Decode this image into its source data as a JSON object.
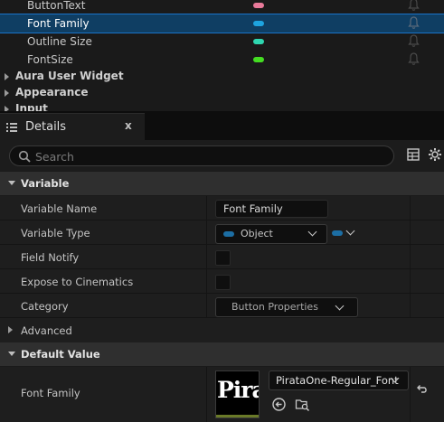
{
  "variables": [
    {
      "name": "ButtonText",
      "color": "#e87a9a",
      "selected": false
    },
    {
      "name": "Font Family",
      "color": "#1ea4e0",
      "selected": true
    },
    {
      "name": "Outline Size",
      "color": "#2ed6b0",
      "selected": false
    },
    {
      "name": "FontSize",
      "color": "#44dd22",
      "selected": false
    }
  ],
  "categories": [
    {
      "name": "Aura User Widget"
    },
    {
      "name": "Appearance"
    },
    {
      "name": "Input"
    }
  ],
  "tab": {
    "label": "Details",
    "close": "x"
  },
  "search": {
    "placeholder": "Search",
    "value": ""
  },
  "sections": {
    "variable": "Variable",
    "advanced": "Advanced",
    "default_value": "Default Value"
  },
  "props": {
    "variable_name": {
      "label": "Variable Name",
      "value": "Font Family"
    },
    "variable_type": {
      "label": "Variable Type",
      "value": "Object"
    },
    "field_notify": {
      "label": "Field Notify"
    },
    "expose": {
      "label": "Expose to Cinematics"
    },
    "category": {
      "label": "Category",
      "value": "Button Properties"
    },
    "font_family": {
      "label": "Font Family",
      "value": "PirataOne-Regular_Font",
      "thumb_text": "Pira"
    }
  },
  "colors": {
    "selection": "#0f3e63",
    "type_object": "#1c6ea4"
  }
}
